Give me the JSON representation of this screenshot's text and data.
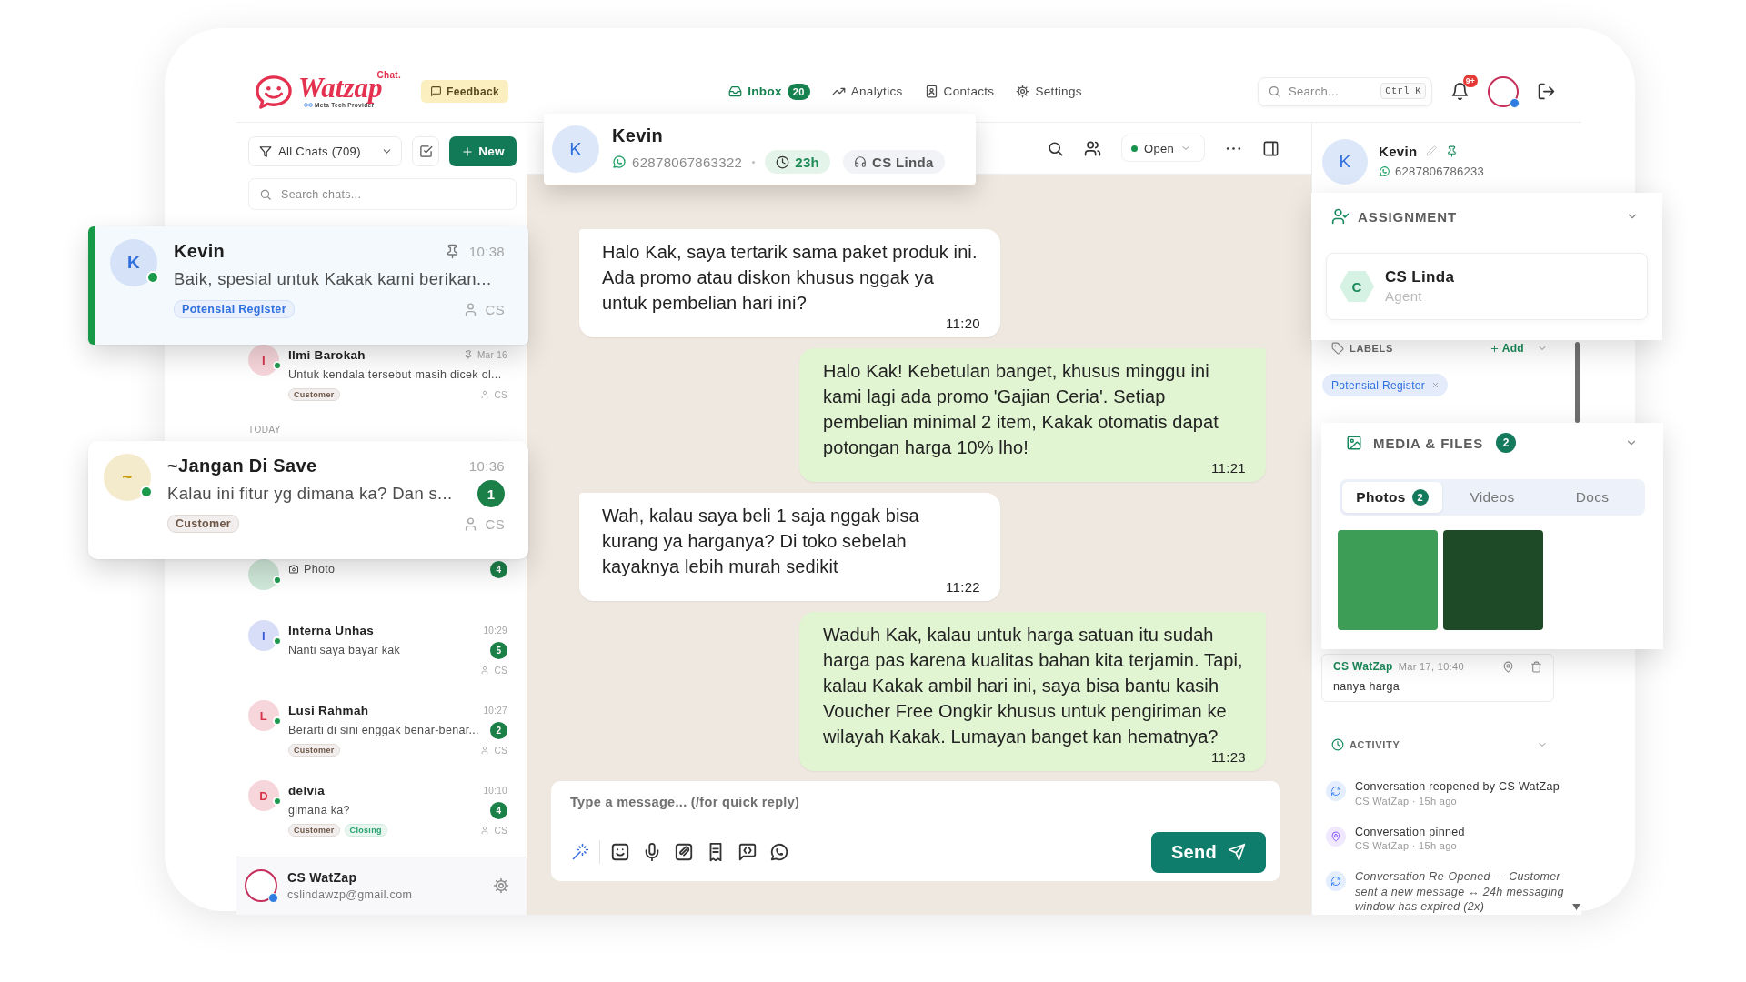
{
  "topbar": {
    "logo": {
      "wordmark": "Watzap",
      "superscript": "Chat.",
      "tagline": "Meta Tech Provider"
    },
    "feedback": "Feedback",
    "nav": [
      {
        "label": "Inbox",
        "badge": "20",
        "selected": true
      },
      {
        "label": "Analytics",
        "selected": false
      },
      {
        "label": "Contacts",
        "selected": false
      },
      {
        "label": "Settings",
        "selected": false
      }
    ],
    "search": {
      "placeholder": "Search...",
      "shortcut": "Ctrl K"
    },
    "notifications": "9+"
  },
  "sidebar": {
    "filter": "All Chats (709)",
    "new_button": "New",
    "search": {
      "placeholder": "Search chats..."
    },
    "chats": [
      {
        "kind": "card",
        "selected": true,
        "avatar": "K",
        "color": "#2f6fde",
        "online": true,
        "name": "Kevin",
        "pinned": true,
        "time": "10:38",
        "media": false,
        "preview": "Baik, spesial untuk Kakak kami berikan...",
        "labels": [
          {
            "text": "Potensial Register",
            "color": "#2f6fde"
          }
        ],
        "assignee": "CS"
      },
      {
        "kind": "row",
        "selected": false,
        "avatar": "I",
        "color": "#d8334a",
        "online": true,
        "name": "Ilmi Barokah",
        "pinned": true,
        "time": "Mar 16",
        "media": false,
        "preview": "Untuk kendala tersebut masih dicek ol...",
        "labels": [
          {
            "text": "Customer",
            "color": "#6e5646"
          }
        ],
        "assignee": "CS"
      },
      {
        "kind": "section",
        "label": "TODAY"
      },
      {
        "kind": "card",
        "selected": false,
        "avatar": "~",
        "color": "#c99a06",
        "online": true,
        "name": "~Jangan Di Save",
        "pinned": false,
        "time": "10:36",
        "media": false,
        "preview": "Kalau ini fitur yg dimana ka? Dan s...",
        "unread": "1",
        "labels": [
          {
            "text": "Customer",
            "color": "#6e5646"
          }
        ],
        "assignee": "CS"
      },
      {
        "kind": "row",
        "selected": false,
        "color": "#cfe8d8",
        "online": true,
        "media": true,
        "preview": "Photo",
        "unread": "4"
      },
      {
        "kind": "row",
        "selected": false,
        "avatar": "I",
        "color": "#3b5bdb",
        "online": true,
        "name": "Interna Unhas",
        "pinned": false,
        "time": "10:29",
        "media": false,
        "preview": "Nanti saya bayar kak",
        "unread": "5",
        "assignee": "CS"
      },
      {
        "kind": "row",
        "selected": false,
        "avatar": "L",
        "color": "#d8334a",
        "online": true,
        "name": "Lusi Rahmah",
        "pinned": false,
        "time": "10:27",
        "media": false,
        "preview": "Berarti di sini enggak benar-benar...",
        "unread": "2",
        "labels": [
          {
            "text": "Customer",
            "color": "#6e5646"
          }
        ],
        "assignee": "CS"
      },
      {
        "kind": "row",
        "selected": false,
        "avatar": "D",
        "color": "#d8334a",
        "online": true,
        "name": "delvia",
        "pinned": false,
        "time": "10:10",
        "media": false,
        "preview": "gimana ka?",
        "unread": "4",
        "labels": [
          {
            "text": "Customer",
            "color": "#6e5646"
          },
          {
            "text": "Closing",
            "color": "#23a26d"
          }
        ],
        "assignee": "CS"
      }
    ],
    "account": {
      "name": "CS WatZap",
      "email": "cslindawzp@gmail.com"
    }
  },
  "chat": {
    "header": {
      "avatar": "K",
      "name": "Kevin",
      "phone": "62878067863322",
      "window": "23h",
      "agent": "CS Linda",
      "status": "Open"
    },
    "messages": [
      {
        "kind": "incoming",
        "text": "Halo Kak, saya tertarik sama paket produk ini. Ada promo atau diskon khusus nggak ya untuk pembelian hari ini?",
        "time": "11:20"
      },
      {
        "kind": "outgoing",
        "text": "Halo Kak! Kebetulan banget, khusus minggu ini kami lagi ada promo 'Gajian Ceria'. Setiap pembelian minimal 2 item, Kakak otomatis dapat potongan harga 10% lho!",
        "time": "11:21"
      },
      {
        "kind": "incoming",
        "text": "Wah, kalau saya beli 1 saja nggak bisa kurang ya harganya? Di toko sebelah kayaknya lebih murah sedikit",
        "time": "11:22"
      },
      {
        "kind": "outgoing",
        "text": "Waduh Kak, kalau untuk harga satuan itu sudah harga pas karena kualitas bahan kita terjamin. Tapi, kalau Kakak ambil hari ini, saya bisa bantu kasih Voucher Free Ongkir khusus untuk pengiriman ke wilayah Kakak. Lumayan banget kan hematnya?",
        "time": "11:23"
      }
    ],
    "composer": {
      "placeholder": "Type a message... (/for quick reply)",
      "send": "Send"
    }
  },
  "details": {
    "contact": {
      "avatar": "K",
      "name": "Kevin",
      "pinned": true,
      "phone": "6287806786233"
    },
    "assignment": {
      "title": "ASSIGNMENT",
      "avatar": "C",
      "agent": "CS Linda",
      "role": "Agent"
    },
    "labels": {
      "title": "LABELS",
      "add": "Add",
      "items": [
        {
          "text": "Potensial Register",
          "color": "#2f6fde"
        }
      ]
    },
    "media": {
      "title": "MEDIA & FILES",
      "count": "2",
      "tabs": [
        {
          "label": "Photos",
          "count": "2",
          "selected": true
        },
        {
          "label": "Videos",
          "selected": false
        },
        {
          "label": "Docs",
          "selected": false
        }
      ],
      "photos": [
        {
          "color": "#3d9c55"
        },
        {
          "color": "#1f4a28"
        }
      ]
    },
    "note": {
      "author": "CS WatZap",
      "time": "Mar 17, 10:40",
      "text": "nanya harga"
    },
    "activity": {
      "title": "ACTIVITY",
      "items": [
        {
          "kind": "reopened",
          "text": "Conversation reopened by CS WatZap",
          "meta": "CS WatZap · 15h ago"
        },
        {
          "kind": "pinned",
          "text": "Conversation pinned",
          "meta": "CS WatZap · 15h ago"
        },
        {
          "kind": "system",
          "text": "Conversation Re-Opened — Customer sent a new message ↔ 24h messaging window has expired (2x)"
        }
      ]
    }
  }
}
